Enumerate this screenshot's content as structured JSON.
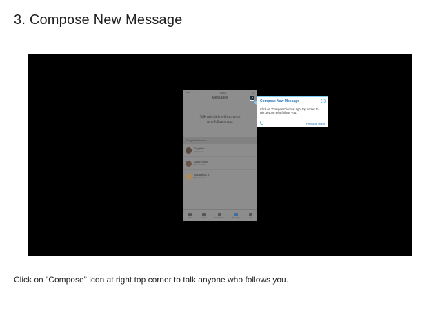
{
  "slide": {
    "title": "3. Compose New Message",
    "caption": "Click on \"Compose\" icon at right top corner to talk anyone who follows you."
  },
  "phone": {
    "status_carrier": "•••••• ᯤ",
    "status_time": "09:41",
    "status_battery": "▭",
    "nav_title": "Messages",
    "empty_text": "Talk privately with anyone who follows you.",
    "suggested_header": "Suggested users",
    "users": [
      {
        "name": "Gayathri",
        "handle": "@shrisofia",
        "avatar_color": "#5b4a40"
      },
      {
        "name": "Sutan Dorji",
        "handle": "@sutandorjii",
        "avatar_color": "#6b5548"
      },
      {
        "name": "Aishwarya R",
        "handle": "@aishwaryar",
        "avatar_color": "#b08a5a"
      }
    ],
    "tabs": [
      {
        "label": "Home",
        "icon": "home-icon"
      },
      {
        "label": "Search",
        "icon": "search-icon"
      },
      {
        "label": "Notifications",
        "icon": "notifications-icon"
      },
      {
        "label": "Messages",
        "icon": "messages-icon"
      },
      {
        "label": "Me",
        "icon": "profile-icon"
      }
    ]
  },
  "tooltip": {
    "title": "Compose New Message",
    "close_icon": "close-icon",
    "body": "Click on \"Compose\" icon at right top corner to talk anyone who follows you.",
    "nav": "Previous | Next",
    "accent": "#7fd0f5"
  },
  "colors": {
    "video_bg": "#000000",
    "tooltip_title": "#1f6fb2"
  }
}
